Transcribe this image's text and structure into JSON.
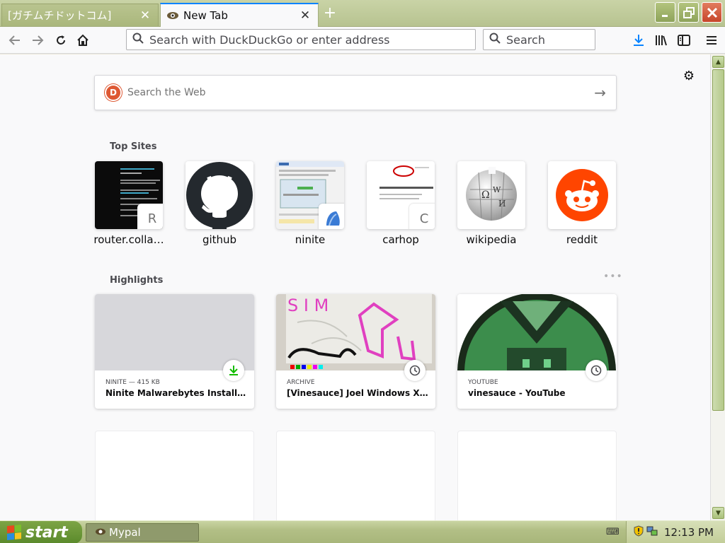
{
  "tabs": [
    {
      "label": "[ガチムチドットコム]",
      "active": false
    },
    {
      "label": "New Tab",
      "active": true
    }
  ],
  "toolbar": {
    "url_placeholder": "Search with DuckDuckGo or enter address",
    "search_placeholder": "Search"
  },
  "web_search": {
    "placeholder": "Search the Web"
  },
  "top_sites": {
    "title": "Top Sites",
    "items": [
      {
        "label": "router.colla…",
        "letter": "R"
      },
      {
        "label": "github",
        "letter": ""
      },
      {
        "label": "ninite",
        "letter": ""
      },
      {
        "label": "carhop",
        "letter": "C"
      },
      {
        "label": "wikipedia",
        "letter": ""
      },
      {
        "label": "reddit",
        "letter": ""
      }
    ]
  },
  "highlights": {
    "title": "Highlights",
    "menu": "•••",
    "items": [
      {
        "context": "NINITE — 415 KB",
        "title": "Ninite Malwarebytes Installer.exe",
        "badge": "download-icon"
      },
      {
        "context": "ARCHIVE",
        "title": "[Vinesauce] Joel Windows XP De…",
        "badge": "clock-icon"
      },
      {
        "context": "YOUTUBE",
        "title": "vinesauce - YouTube",
        "badge": "clock-icon"
      }
    ]
  },
  "taskbar": {
    "start_label": "start",
    "task_label": "Mypal",
    "clock": "12:13 PM"
  },
  "colors": {
    "accent": "#0a84ff",
    "titlebar": "#b7c390",
    "ddg": "#de5833",
    "reddit": "#ff4500",
    "download_green": "#12bc00"
  }
}
